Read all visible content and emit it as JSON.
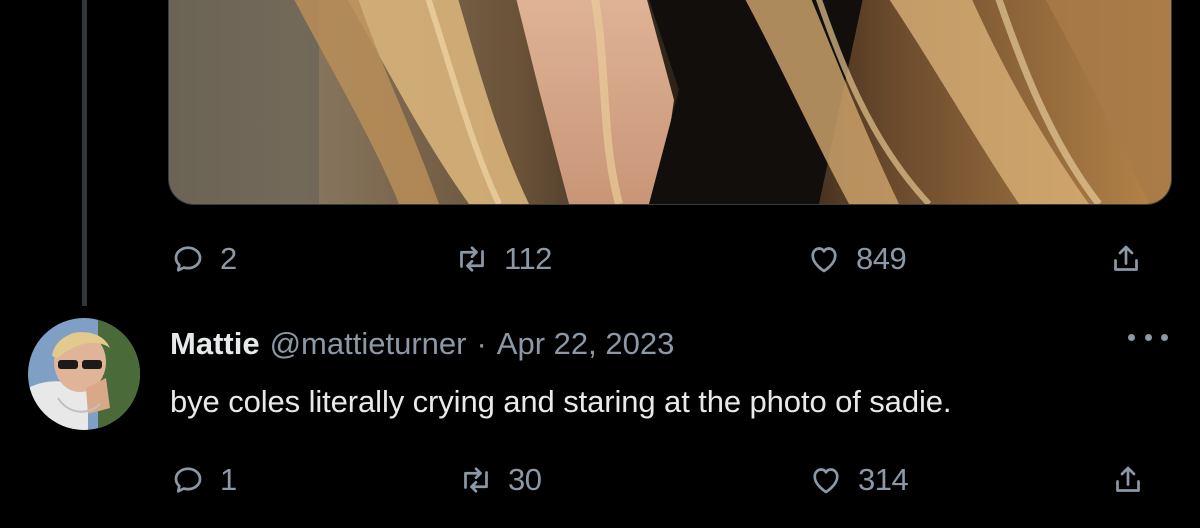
{
  "parent_tweet": {
    "stats": {
      "replies": "2",
      "retweets": "112",
      "likes": "849"
    }
  },
  "reply_tweet": {
    "display_name": "Mattie",
    "handle": "@mattieturner",
    "separator": "·",
    "timestamp": "Apr 22, 2023",
    "text": "bye coles literally crying and staring at the photo of sadie.",
    "stats": {
      "replies": "1",
      "retweets": "30",
      "likes": "314"
    }
  },
  "icons": {
    "reply": "reply-icon",
    "retweet": "retweet-icon",
    "like": "like-icon",
    "share": "share-icon",
    "more": "more-icon"
  },
  "colors": {
    "background": "#000000",
    "primary_text": "#e7e9ea",
    "secondary_text": "#8b98a5",
    "thread_line": "#333639"
  }
}
